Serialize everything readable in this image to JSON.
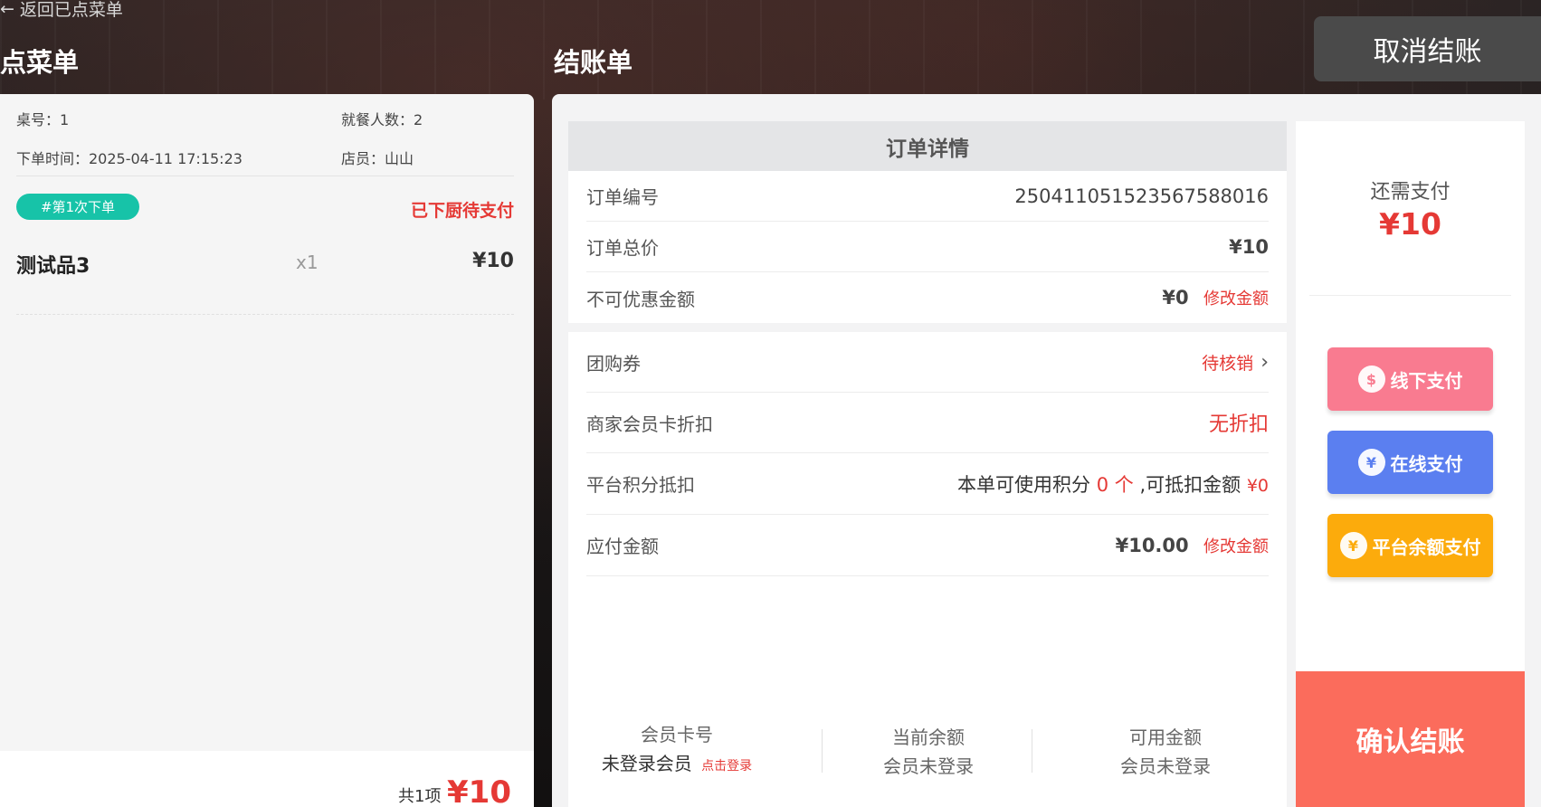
{
  "nav": {
    "back_label": "返回已点菜单"
  },
  "titles": {
    "order_list": "点菜单",
    "checkout": "结账单"
  },
  "cancel_label": "取消结账",
  "order_info": {
    "table_label": "桌号：1",
    "diners_label": "就餐人数：2",
    "time_label": "下单时间：2025-04-11 17:15:23",
    "staff_label": "店员：山山"
  },
  "batch": {
    "badge": "#第1次下单",
    "status": "已下厨待支付"
  },
  "items": [
    {
      "name": "测试品3",
      "qty": "x1",
      "price": "¥10"
    }
  ],
  "summary": {
    "count_label": "共1项",
    "total": "¥10"
  },
  "details": {
    "header": "订单详情",
    "order_no_label": "订单编号",
    "order_no": "250411051523567588016",
    "total_label": "订单总价",
    "total": "¥10",
    "non_discount_label": "不可优惠金额",
    "non_discount": "¥0",
    "edit_amount": "修改金额",
    "coupon_label": "团购券",
    "coupon_status": "待核销",
    "member_discount_label": "商家会员卡折扣",
    "member_discount": "无折扣",
    "points_label": "平台积分抵扣",
    "points_text_a": "本单可使用积分",
    "points_count": "0 个",
    "points_text_b": ",可抵扣金额",
    "points_amount": "¥0",
    "payable_label": "应付金额",
    "payable": "¥10.00"
  },
  "member": {
    "card_label": "会员卡号",
    "card_value": "未登录会员",
    "login_link": "点击登录",
    "balance_label": "当前余额",
    "balance_value": "会员未登录",
    "available_label": "可用金额",
    "available_value": "会员未登录"
  },
  "payment": {
    "due_label": "还需支付",
    "due_value": "¥10",
    "offline": {
      "label": "线下支付",
      "color": "#f97b90"
    },
    "online": {
      "label": "在线支付",
      "color": "#5b7ff0"
    },
    "balance": {
      "label": "平台余额支付",
      "color": "#fcab0c"
    },
    "confirm": "确认结账"
  }
}
